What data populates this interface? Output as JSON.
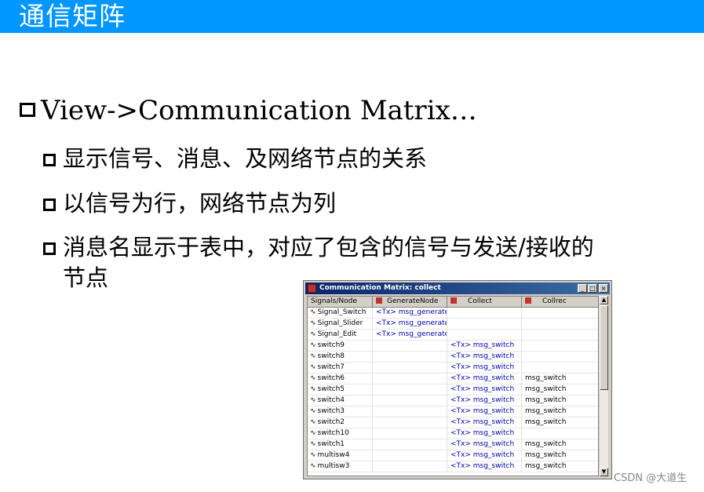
{
  "slide": {
    "title": "通信矩阵",
    "bullet1": "View->Communication Matrix…",
    "sub_bullets": [
      "显示信号、消息、及网络节点的关系",
      "以信号为行，网络节点为列",
      "消息名显示于表中，对应了包含的信号与发送/接收的",
      "节点"
    ]
  },
  "window": {
    "title": "Communication Matrix: collect",
    "buttons": [
      "_",
      "□",
      "×"
    ],
    "columns": [
      "Signals/Node",
      "GenerateNode",
      "Collect",
      "Collrec"
    ],
    "rows": [
      {
        "signal": "Signal_Switch",
        "generate": "<Tx> msg_generate",
        "collect": "",
        "collrec": ""
      },
      {
        "signal": "Signal_Slider",
        "generate": "<Tx> msg_generate",
        "collect": "",
        "collrec": ""
      },
      {
        "signal": "Signal_Edit",
        "generate": "<Tx> msg_generate",
        "collect": "",
        "collrec": ""
      },
      {
        "signal": "switch9",
        "generate": "",
        "collect": "<Tx> msg_switch",
        "collrec": ""
      },
      {
        "signal": "switch8",
        "generate": "",
        "collect": "<Tx> msg_switch",
        "collrec": ""
      },
      {
        "signal": "switch7",
        "generate": "",
        "collect": "<Tx> msg_switch",
        "collrec": ""
      },
      {
        "signal": "switch6",
        "generate": "",
        "collect": "<Tx> msg_switch",
        "collrec": "msg_switch"
      },
      {
        "signal": "switch5",
        "generate": "",
        "collect": "<Tx> msg_switch",
        "collrec": "msg_switch"
      },
      {
        "signal": "switch4",
        "generate": "",
        "collect": "<Tx> msg_switch",
        "collrec": "msg_switch"
      },
      {
        "signal": "switch3",
        "generate": "",
        "collect": "<Tx> msg_switch",
        "collrec": "msg_switch"
      },
      {
        "signal": "switch2",
        "generate": "",
        "collect": "<Tx> msg_switch",
        "collrec": "msg_switch"
      },
      {
        "signal": "switch10",
        "generate": "",
        "collect": "<Tx> msg_switch",
        "collrec": ""
      },
      {
        "signal": "switch1",
        "generate": "",
        "collect": "<Tx> msg_switch",
        "collrec": "msg_switch"
      },
      {
        "signal": "multisw4",
        "generate": "",
        "collect": "<Tx> msg_switch",
        "collrec": "msg_switch"
      },
      {
        "signal": "multisw3",
        "generate": "",
        "collect": "<Tx> msg_switch",
        "collrec": "msg_switch"
      }
    ]
  },
  "watermark": "CSDN @大道生",
  "colors": {
    "title_bar": "#0096ff",
    "tx_text": "#0000b0"
  }
}
